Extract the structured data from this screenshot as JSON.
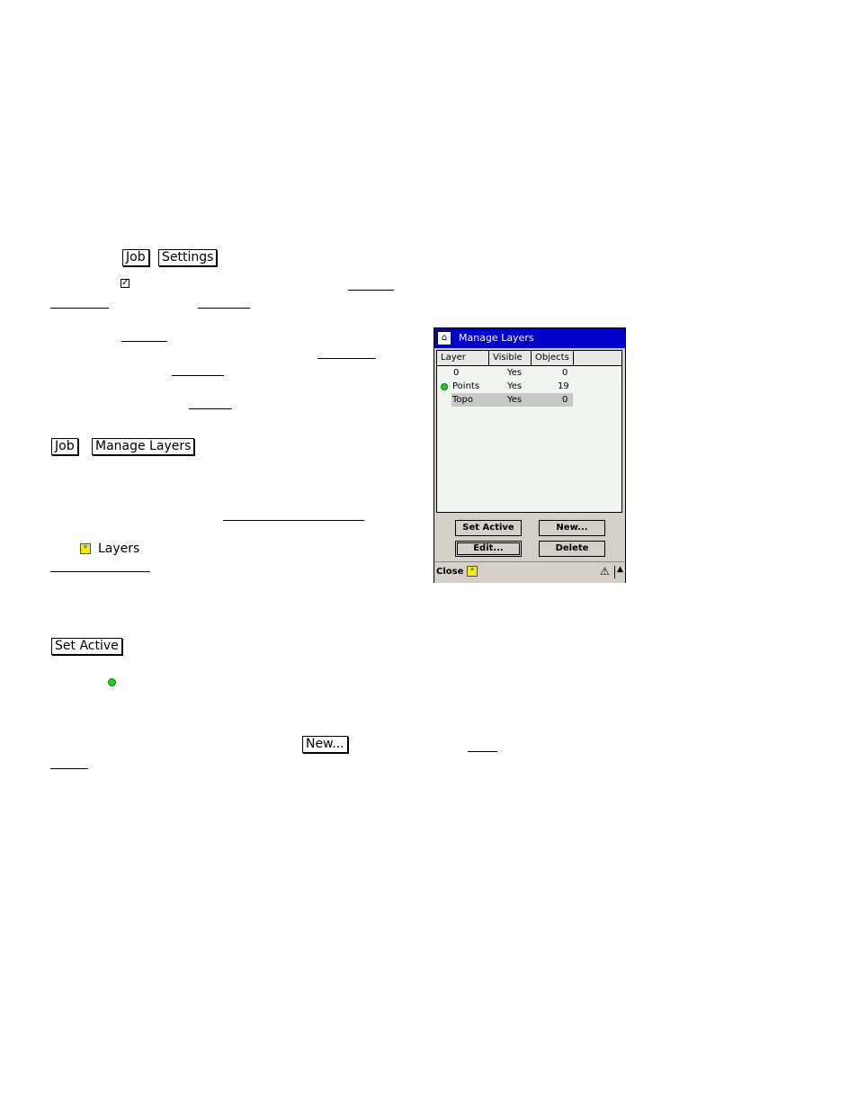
{
  "doc": {
    "job_button": "Job",
    "settings_button": "Settings",
    "manage_layers_button": "Manage Layers",
    "layers_label": "Layers",
    "set_active_button": "Set Active",
    "new_button": "New..."
  },
  "dialog": {
    "title": "Manage Layers",
    "columns": [
      "Layer",
      "Visible",
      "Objects"
    ],
    "rows": [
      {
        "layer": "0",
        "visible": "Yes",
        "objects": "0"
      },
      {
        "layer": "Points",
        "visible": "Yes",
        "objects": "19"
      },
      {
        "layer": "Topo",
        "visible": "Yes",
        "objects": "0"
      }
    ],
    "buttons": {
      "set_active": "Set Active",
      "new": "New...",
      "edit": "Edit...",
      "delete": "Delete"
    },
    "status_close": "Close"
  }
}
